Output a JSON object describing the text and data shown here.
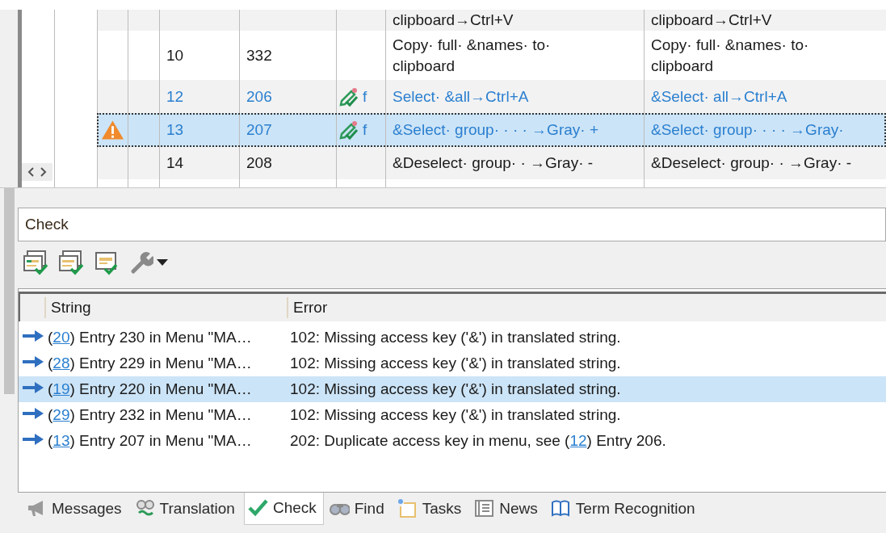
{
  "grid": {
    "rows": [
      {
        "id": "",
        "number": "",
        "edited": false,
        "warning": false,
        "changed": false,
        "selected": false,
        "col_5": "",
        "source": "clipboard→Ctrl+V",
        "target": "clipboard→Ctrl+V"
      },
      {
        "id": "10",
        "number": "332",
        "edited": false,
        "warning": false,
        "changed": false,
        "selected": false,
        "col_5": "",
        "source": "Copy· full· &names· to·\nclipboard",
        "target": "Copy· full· &names· to·\nclipboard"
      },
      {
        "id": "12",
        "number": "206",
        "edited": true,
        "warning": false,
        "changed": true,
        "selected": false,
        "col_5": "f",
        "source": "Select· &all→Ctrl+A",
        "target": "&Select· all→Ctrl+A"
      },
      {
        "id": "13",
        "number": "207",
        "edited": true,
        "warning": true,
        "changed": true,
        "selected": true,
        "col_5": "f",
        "source": "&Select· group· · · · →Gray· +",
        "target": "&Select· group· · · · →Gray·"
      },
      {
        "id": "14",
        "number": "208",
        "edited": false,
        "warning": false,
        "changed": false,
        "selected": false,
        "col_5": "",
        "source": "&Deselect· group· · →Gray· -",
        "target": "&Deselect· group· · →Gray· -"
      }
    ]
  },
  "check": {
    "title": "Check",
    "columns": [
      "String",
      "Error"
    ],
    "rows": [
      {
        "selected": false,
        "before": "(",
        "ref": "20",
        "after": ") Entry 230 in Menu \"MA…",
        "error": "102: Missing access key ('&') in translated string."
      },
      {
        "selected": false,
        "before": "(",
        "ref": "28",
        "after": ") Entry 229 in Menu \"MA…",
        "error": "102: Missing access key ('&') in translated string."
      },
      {
        "selected": true,
        "before": "(",
        "ref": "19",
        "after": ") Entry 220 in Menu \"MA…",
        "error": "102: Missing access key ('&') in translated string."
      },
      {
        "selected": false,
        "before": "(",
        "ref": "29",
        "after": ") Entry 232 in Menu \"MA…",
        "error": "102: Missing access key ('&') in translated string."
      },
      {
        "selected": false,
        "before": "(",
        "ref": "13",
        "after": ") Entry 207 in Menu \"MA…",
        "error": "202: Duplicate access key in menu, see (",
        "error_ref": "12",
        "error_after": ") Entry 206."
      }
    ]
  },
  "tabs": [
    {
      "kind": "messages",
      "label": "Messages",
      "selected": false
    },
    {
      "kind": "translation",
      "label": "Translation",
      "selected": false
    },
    {
      "kind": "check",
      "label": "Check",
      "selected": true
    },
    {
      "kind": "find",
      "label": "Find",
      "selected": false
    },
    {
      "kind": "tasks",
      "label": "Tasks",
      "selected": false
    },
    {
      "kind": "news",
      "label": "News",
      "selected": false
    },
    {
      "kind": "terms",
      "label": "Term Recognition",
      "selected": false
    }
  ]
}
